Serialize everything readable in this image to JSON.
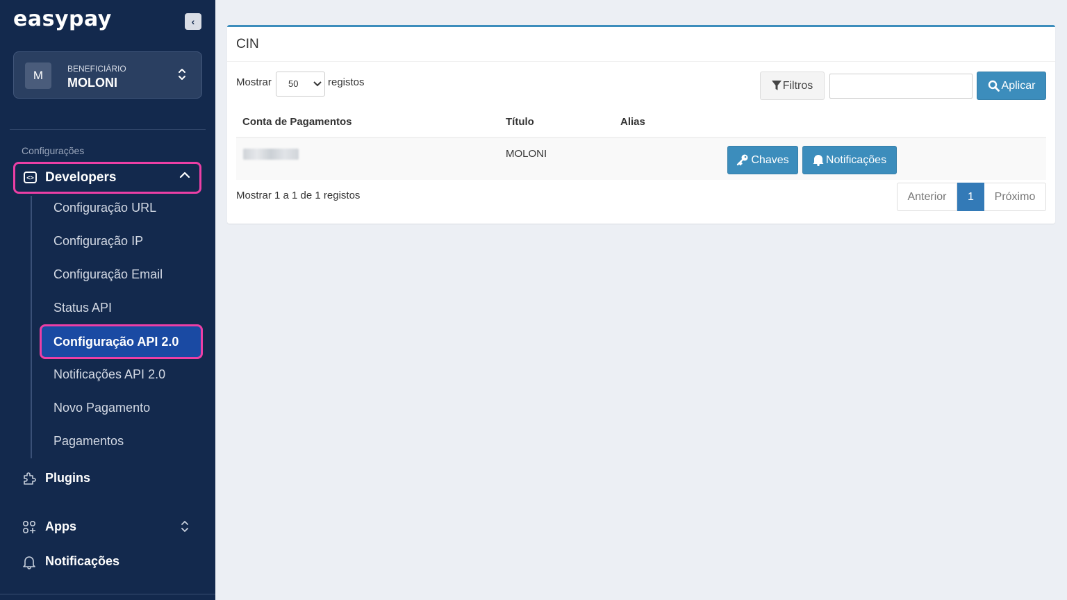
{
  "sidebar": {
    "logo": "easypay",
    "collapse_icon": "chevron-left-icon",
    "beneficiary": {
      "avatar": "M",
      "label": "BENEFICIÁRIO",
      "name": "MOLONI"
    },
    "section_label": "Configurações",
    "developers": {
      "label": "Developers",
      "expanded": true
    },
    "sub_items": [
      {
        "label": "Configuração URL"
      },
      {
        "label": "Configuração IP"
      },
      {
        "label": "Configuração Email"
      },
      {
        "label": "Status API"
      },
      {
        "label": "Configuração API 2.0",
        "active": true
      },
      {
        "label": "Notificações API 2.0"
      },
      {
        "label": "Novo Pagamento"
      },
      {
        "label": "Pagamentos"
      }
    ],
    "main_items": [
      {
        "label": "Plugins",
        "icon": "puzzle-icon"
      },
      {
        "label": "Apps",
        "icon": "apps-icon"
      },
      {
        "label": "Notificações",
        "icon": "bell-icon"
      }
    ],
    "colors": {
      "background": "#13294d",
      "highlight": "#ec3fa5",
      "active": "#1a4aa3"
    }
  },
  "panel": {
    "title": "CIN",
    "show_label": "Mostrar",
    "page_size": "50",
    "records_label": "registos",
    "filter_label": "Filtros",
    "search_value": "",
    "apply_label": "Aplicar",
    "columns": [
      "Conta de Pagamentos",
      "Título",
      "Alias"
    ],
    "rows": [
      {
        "account": "",
        "title": "MOLONI",
        "alias": ""
      }
    ],
    "row_actions": [
      "Chaves",
      "Notificações"
    ],
    "info": "Mostrar 1 a 1 de 1 registos",
    "pagination": {
      "prev": "Anterior",
      "current": "1",
      "next": "Próximo"
    },
    "colors": {
      "primary": "#3c8dbc",
      "page_active": "#337ab7"
    }
  }
}
